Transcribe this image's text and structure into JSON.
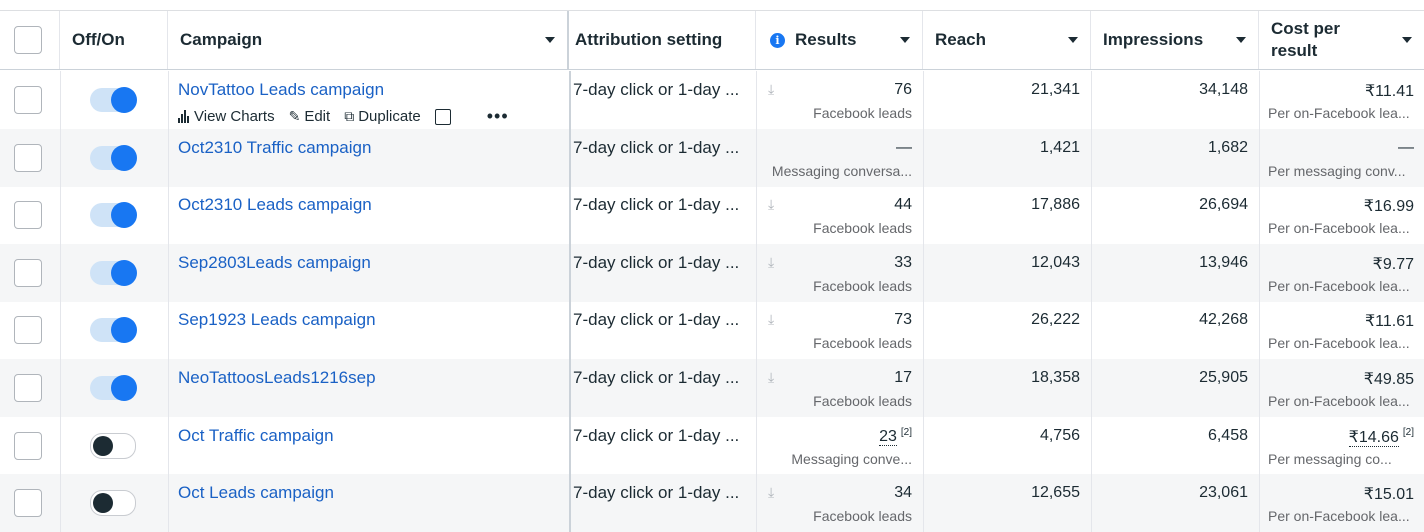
{
  "header": {
    "off_on": "Off/On",
    "campaign": "Campaign",
    "attribution": "Attribution setting",
    "results": "Results",
    "reach": "Reach",
    "impressions": "Impressions",
    "cost_per_result_line1": "Cost per",
    "cost_per_result_line2": "result",
    "info_glyph": "i"
  },
  "row_actions": {
    "view_charts": "View Charts",
    "edit": "Edit",
    "duplicate": "Duplicate",
    "more": "•••"
  },
  "rows": [
    {
      "name": "NovTattoo Leads campaign",
      "on": true,
      "attribution": "7-day click or 1-day ...",
      "results": "76",
      "results_sub": "Facebook leads",
      "reach": "21,341",
      "impressions": "34,148",
      "cost": "₹11.41",
      "cost_sub": "Per on-Facebook lea..."
    },
    {
      "name": "Oct2310 Traffic campaign",
      "on": true,
      "attribution": "7-day click or 1-day ...",
      "results": "—",
      "results_sub": "Messaging conversa...",
      "reach": "1,421",
      "impressions": "1,682",
      "cost": "—",
      "cost_sub": "Per messaging conv..."
    },
    {
      "name": "Oct2310 Leads campaign",
      "on": true,
      "attribution": "7-day click or 1-day ...",
      "results": "44",
      "results_sub": "Facebook leads",
      "reach": "17,886",
      "impressions": "26,694",
      "cost": "₹16.99",
      "cost_sub": "Per on-Facebook lea..."
    },
    {
      "name": "Sep2803Leads campaign",
      "on": true,
      "attribution": "7-day click or 1-day ...",
      "results": "33",
      "results_sub": "Facebook leads",
      "reach": "12,043",
      "impressions": "13,946",
      "cost": "₹9.77",
      "cost_sub": "Per on-Facebook lea..."
    },
    {
      "name": "Sep1923 Leads campaign",
      "on": true,
      "attribution": "7-day click or 1-day ...",
      "results": "73",
      "results_sub": "Facebook leads",
      "reach": "26,222",
      "impressions": "42,268",
      "cost": "₹11.61",
      "cost_sub": "Per on-Facebook lea..."
    },
    {
      "name": "NeoTattoosLeads1216sep",
      "on": true,
      "attribution": "7-day click or 1-day ...",
      "results": "17",
      "results_sub": "Facebook leads",
      "reach": "18,358",
      "impressions": "25,905",
      "cost": "₹49.85",
      "cost_sub": "Per on-Facebook lea..."
    },
    {
      "name": "Oct Traffic campaign",
      "on": false,
      "attribution": "7-day click or 1-day ...",
      "results": "23",
      "results_sub": "Messaging conve...",
      "reach": "4,756",
      "impressions": "6,458",
      "cost": "₹14.66",
      "cost_sub": "Per messaging co...",
      "footnote": "[2]"
    },
    {
      "name": "Oct Leads campaign",
      "on": false,
      "attribution": "7-day click or 1-day ...",
      "results": "34",
      "results_sub": "Facebook leads",
      "reach": "12,655",
      "impressions": "23,061",
      "cost": "₹15.01",
      "cost_sub": "Per on-Facebook lea..."
    }
  ],
  "colors": {
    "link": "#1a61c5",
    "toggle_on": "#1877f2",
    "toggle_off": "#1c2b33"
  }
}
